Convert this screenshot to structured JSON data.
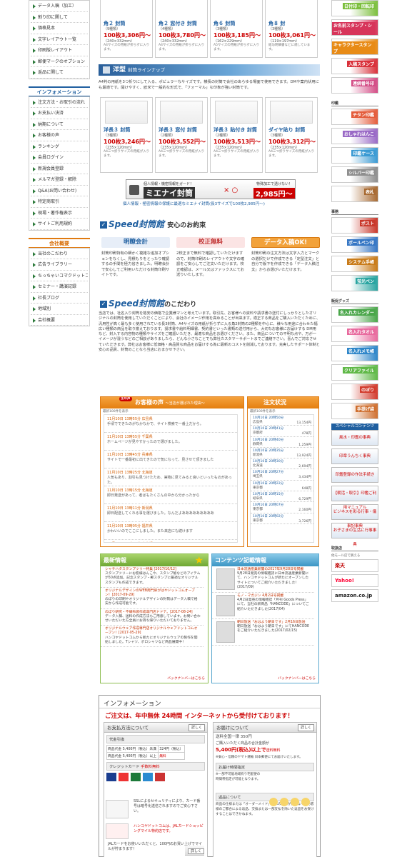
{
  "left_nav_top": [
    "データ入稿（加工）",
    "割り印に関して",
    "価格見本",
    "文字レイアウト一覧",
    "印刷版レイアウト",
    "郵便マークのオプション",
    "返品に関して"
  ],
  "left_info": {
    "title": "インフォメーション",
    "items": [
      "注文方法・お取引の流れ",
      "お支払い決済",
      "納期について",
      "お客様の声",
      "ランキング",
      "会員ログイン",
      "新規会員登録",
      "メルマガ登録・解除",
      "Q&A(お問い合わせ)",
      "特定商取引",
      "現場・著作権表示",
      "サイトご利用規約"
    ]
  },
  "left_company": {
    "title": "会社概要",
    "items": [
      "当社のこだわり",
      "広告ライブラリー",
      "ちっちゃいコマクドットコム",
      "セミナー・講演記録",
      "社長ブログ",
      "地域別",
      "会社概要"
    ]
  },
  "kaku_cards": [
    {
      "name": "角２ 封筒",
      "types": "（9種類）",
      "price": "100枚3,306円〜",
      "size": "（240×332mm）",
      "note": "A4サイズの用紙が折らずに入ります。"
    },
    {
      "name": "角２ 窓付き 封筒",
      "types": "（4種類）",
      "price": "100枚3,780円〜",
      "size": "（240×332mm）",
      "note": "A4サイズの用紙が折らずに入ります。"
    },
    {
      "name": "角６ 封筒",
      "types": "（3種類）",
      "price": "100枚3,185円〜",
      "size": "（162×229mm）",
      "note": "A5サイズの用紙が折らずに入ります。"
    },
    {
      "name": "角８ 封",
      "types": "（3種類）",
      "price": "100枚3,061円〜",
      "size": "（119×197mm）",
      "note": "給与明細書などに適しています。"
    }
  ],
  "yogata": {
    "title": "洋型",
    "subtitle": "封筒ラインナップ",
    "desc": "A4判の用紙を3つ折りにして入る、ポピュラーなサイズです。横長の封筒で会社のあらゆる場面で使用できます。DMや案内状用にも最適です。開けやすく、欧米で一般的な形式で、「フォーマル」な印象が強い封筒です。",
    "cards": [
      {
        "name": "洋長３ 封筒",
        "types": "（3種類）",
        "price": "100枚3,246円〜",
        "size": "（235×120mm）",
        "note": "A4三つ折りサイズの用紙が入ります。"
      },
      {
        "name": "洋長３ 窓付 封筒",
        "types": "（2種類）",
        "price": "100枚3,552円〜",
        "size": "（235×120mm）",
        "note": "A4三つ折りサイズの用紙が入ります。"
      },
      {
        "name": "洋長３ 貼付き 封筒",
        "types": "（2種類）",
        "price": "100枚3,513円〜",
        "size": "（235×120mm）",
        "note": "A4三つ折りサイズの用紙が入ります。"
      },
      {
        "name": "ダイヤ貼り 封筒",
        "types": "（3種類）",
        "price": "100枚3,312円〜",
        "size": "（235×120mm）",
        "note": "A4三つ折りサイズの用紙が入ります。"
      }
    ]
  },
  "mienai": {
    "label": "個人情報・機密情報をガード！",
    "brand": "ミエナイ封筒",
    "marks": "× ○",
    "spec": "特殊加工で透けない！",
    "price": "2,985円〜",
    "caption": "個人情報・極密情報の保護に最適なミエナイ封筒(長3サイズで100枚2,985円〜)"
  },
  "promise": {
    "brand": "Speed封筒館",
    "title": "安心のお約束",
    "items": [
      {
        "head": "明瞭会計",
        "text": "封筒印刷特有の細かく複雑な追加オプションをなくし、見積もりをとったり確認するの手間を極力省きました。明瞭会計で安心してご利用いただける封筒印刷サイトです。"
      },
      {
        "head": "校正無料",
        "text": "2校正まで無料で確認していただけますので、封筒印刷のレイアウトや文字の確認をご安心してご注文いただけます。校正確認は、メール又はファックスにてお送りいたします。"
      },
      {
        "head": "データ入稿OK!",
        "text": "封筒印刷の注文方法は文字入力とマークの選択だけで作成できる「定型注文」と自分で版下を作成できる「データ入稿注文」からお選びいただけます。"
      }
    ]
  },
  "kodawari": {
    "brand": "Speed封筒館",
    "title": "のこだわり",
    "text": "当店では、社名入り封筒を格安の価格で企業様マンと考えています。取引先、お客様への資料や請求書の送付にしっかりとしたオリジナルの封筒を使用していただくことにより、会社のイメージ作用を高めることが出来ます。適正する商品をご購入いただくために、汎用性が高く最も多く使用されている長3封筒、A4サイズの用紙が折らずに入る角2封筒の2種類を中心に、様々な用途に合わせた幅広い種類の商品を取り揃えております。請求書や給料明細書、契約書といった書類の送付用から、大切なお客様にお届けする DM用など、封入する内容物の種類やサイズをご確認いただき、最適な商品をお選びください。また、商品についての不明な点や、万が一イメージが違うなどのご相談がありましたら、どんな小さなことでも弊社カスタマーサポートまでご連絡下さい。喜んでご対応させていただきます。弊社はお客様に低価格・高品質な商品をお届けする為に最新のコストを削減しております。充実したサポート体制と安心の品質、封筒のことなら当店におまかせ下さい。"
  },
  "voice": {
    "badge": "生の声",
    "title": "お客様の声",
    "subtitle": "〜当店が選ばれた理由〜",
    "caption": "最新100件を表示",
    "rows": [
      {
        "date": "11月10日 13時55分 広島県",
        "text": "手頃でできたのがなかなかで、サイト検索で一番上だから。"
      },
      {
        "date": "11月10日 13時55分 千葉県",
        "text": "ホームページが見やすかったので選びました。"
      },
      {
        "date": "11月10日 13時45分 兵庫県",
        "text": "サイトで一番最初に出てきたので気になって、見させて頂きました"
      },
      {
        "date": "11月10日 13時25分 北海道",
        "text": "人気もあり、割引も見つけたため、実物に見てみると良いといったものがあった。"
      },
      {
        "date": "11月10日 13時15分 北海道",
        "text": "即日発送があって、者ばもたくさんの中から分かったから"
      },
      {
        "date": "11月10日 13時11分 新潟県",
        "text": "即日配送してくれる事を選びました。なんだよあああああああああ"
      },
      {
        "date": "11月10日 13時05分 福井県",
        "text": "かわいいのでここにしました。また来店にも続けます"
      },
      {
        "date": "11月10日 13時02分 東京都",
        "text": "配達の様子が見えてきた満足の施設です。ロリロットしていらっしゃる"
      }
    ]
  },
  "orders": {
    "title": "注文状況",
    "caption": "最新100件を表示",
    "rows": [
      {
        "date": "10月10日 20時50分",
        "pref": "広島県",
        "amount": "13,154円"
      },
      {
        "date": "10月10日 20時41分",
        "pref": "京都府",
        "amount": "478円"
      },
      {
        "date": "10月10日 20時40分",
        "pref": "静岡県",
        "amount": "1,259円"
      },
      {
        "date": "10月10日 20時35分",
        "pref": "新潟県",
        "amount": "13,924円"
      },
      {
        "date": "10月10日 20時30分",
        "pref": "北海道",
        "amount": "2,694円"
      },
      {
        "date": "10月10日 20時27分",
        "pref": "埼玉県",
        "amount": "3,434円"
      },
      {
        "date": "10月10日 20時22分",
        "pref": "東京都",
        "amount": "648円"
      },
      {
        "date": "10月10日 20時15分",
        "pref": "岐阜県",
        "amount": "6,729円"
      },
      {
        "date": "10月10日 20時07分",
        "pref": "東京都",
        "amount": "2,160円"
      },
      {
        "date": "10月10日 20時02分",
        "pref": "東京都",
        "amount": "3,726円"
      }
    ]
  },
  "news": {
    "title": "最新情報",
    "more": "バックナンバーはこちら",
    "items": [
      {
        "title": "シャチハタスタンプツリー特集 [2017/10/12]",
        "text": "スタンプツリーにお客様はんこや、スタンプ帳などのアイテムが50点追加。記念スタンプ・郵スタンプに最適なオリジナルスタンプも作成できます。"
      },
      {
        "title": "オリジナルデザインのWEB用門扉がはやドットコムオープン！[2017-09-29]",
        "text": "のぼりの印刷やオリジナルデザインの封筒はデータ入稿で格安から作成可能です。"
      },
      {
        "title": "のぼり研究・不織布袋作成専門店ドドテ。[2017-08-24]",
        "text": "データ入稿、送料の作成方法もご用意しています。お問い合わせいただいた方全員にお持ち帰りいただいておりません。"
      },
      {
        "title": "オリジナルウェア作成専門店オリジナルウェアドットコムオープン！[2017-05-29]",
        "text": "ハンコヤドットコムから新たにオリジナルウェアの製作を開始しました。Tシャツ、ポロシャツなど商品展開中！"
      }
    ]
  },
  "content": {
    "title": "コンテンツ記載情報",
    "more": "バックナンバーはこちら",
    "items": [
      {
        "title": "日本流通産業新聞の2017年9月28日号掲載",
        "text": "9月28日発売の情報雑誌に日本流通産業新聞にて、ハンコヤドットコムが新たにオープンしたサイトについてご紹介いただきました！(2017/09)"
      },
      {
        "title": "モノ・マガジン 4月2日号掲載",
        "text": "4月2日発売の情報雑誌「月刊 Goods Press」にて、当社の新商品「HANCODE」についてご紹介いただきました(2017/04)"
      },
      {
        "title": "朝日放送「おはよう朝日です」2月16日放送",
        "text": "朝日放送「おはよう朝日です」にてHANCODEをご紹介いただきました(2017/02/15)"
      }
    ]
  },
  "info": {
    "title": "インフォメーション",
    "banner": "ご注文は、年中無休 24時間 インターネットから受付けております！",
    "pay": {
      "title": "お支払方法について",
      "btn": "詳しく",
      "cod": "代金引換",
      "rows": [
        [
          "商品代金 5,400円（税込）未満",
          "324円（税込）"
        ],
        [
          "商品代金 5,400円（税込）以上",
          "無料"
        ]
      ],
      "card": "クレジットカード",
      "card_note": "手数料無料",
      "ssl": "SSLによるセキュリティにより、カード番号は暗号化送信されますのでご安心下さい。",
      "jal": "ハンコヤドットコムは、JALカードショッピングマイル特約店です。",
      "jal_note": "JALカードをお使いいただくと、100円のお買い上げでマイルが貯まります！"
    },
    "ship": {
      "title": "お届けについて",
      "btn": "詳しく",
      "flat": "送料全国一律 350円",
      "free_line": "ご購入いただく商品の合計金額が",
      "free_amount": "5,400円(税込)以上で",
      "free_tail": "送料無料",
      "note": "※安心・信頼のヤマト運輸 日本郵便にてお届けいたします。",
      "time_title": "お届け時間指定",
      "time_note": "※一部不可能地域有り宅配便の時間帯指定が可能となります。",
      "return_title": "返品について",
      "return_text": "商品の仕様または「オーダーメイド」性への配慮が関係なく、お客様のご都合による返品、交換または一部支払を除いた返品をお受けすることはできかねます。"
    }
  },
  "right": {
    "section_labels": [
      "印鑑",
      "事務",
      "販促グッズ",
      "取扱店"
    ],
    "banners": [
      "日付印・回転印",
      "お名前スタンプ・シール",
      "キャラクタースタンプ",
      "入稿スタンプ",
      "連続番号印",
      "チタン印鑑",
      "おしゃれはんこ",
      "印鑑ケース",
      "シルバー印鑑",
      "表札",
      "ポスト",
      "ボールペン印",
      "システム手帳",
      "蛍光ペン",
      "名入れカレンダー",
      "名入れタオル",
      "名入れメモ帳",
      "クリアファイル",
      "のぼり",
      "手提げ袋"
    ],
    "special": "スペシャルコンテンツ",
    "mini": [
      "風水・印鑑の事典",
      "印章うんちく事典",
      "印鑑登録の作法手続き",
      "【朝活・取引】印鑑ご利用マニュアル",
      "ビジネスを彩る行事・儀事記事典",
      "お子さまの生活に行事事典"
    ],
    "shops": [
      "楽天",
      "Yahoo!",
      "amazon.co.jp"
    ],
    "shops_label": "他モール店で買える"
  }
}
